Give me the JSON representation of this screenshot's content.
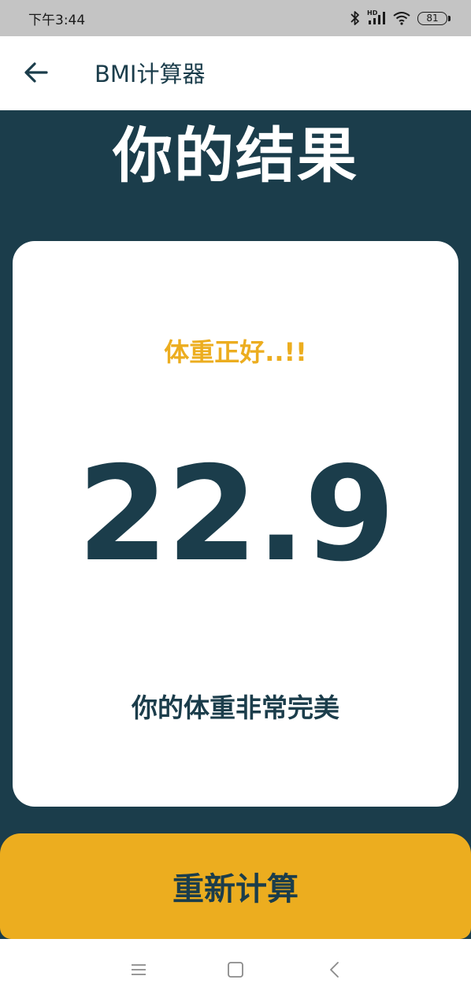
{
  "status_bar": {
    "time": "下午3:44",
    "hd_label": "HD",
    "battery_level": "81",
    "icons": [
      "bluetooth-icon",
      "hd-signal-icon",
      "wifi-icon",
      "battery-icon"
    ]
  },
  "app_bar": {
    "back_icon": "arrow-left-icon",
    "title": "BMI计算器"
  },
  "main": {
    "page_title": "你的结果",
    "result_card": {
      "status_label": "体重正好..!!",
      "bmi_value": "22.9",
      "message": "你的体重非常完美"
    },
    "recalculate_label": "重新计算"
  },
  "nav_bar": {
    "icons": [
      "menu-icon",
      "home-square-icon",
      "back-chevron-icon"
    ]
  },
  "colors": {
    "primary_dark": "#1b3d4b",
    "accent": "#ecad1f",
    "card": "#ffffff",
    "status_bar": "#c4c4c4"
  }
}
